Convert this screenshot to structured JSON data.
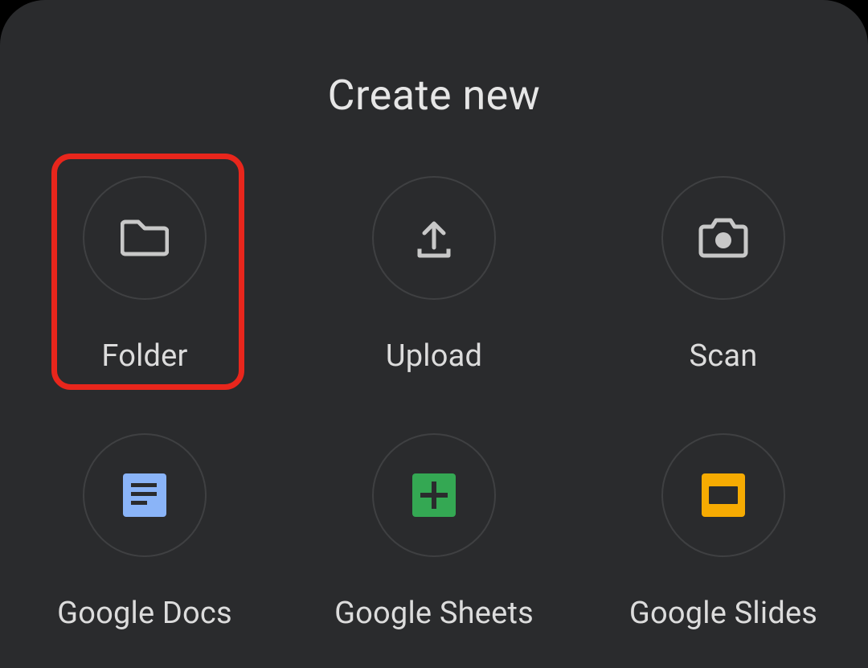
{
  "title": "Create new",
  "items": [
    {
      "label": "Folder",
      "highlighted": true
    },
    {
      "label": "Upload"
    },
    {
      "label": "Scan"
    },
    {
      "label": "Google Docs"
    },
    {
      "label": "Google Sheets"
    },
    {
      "label": "Google Slides"
    }
  ]
}
